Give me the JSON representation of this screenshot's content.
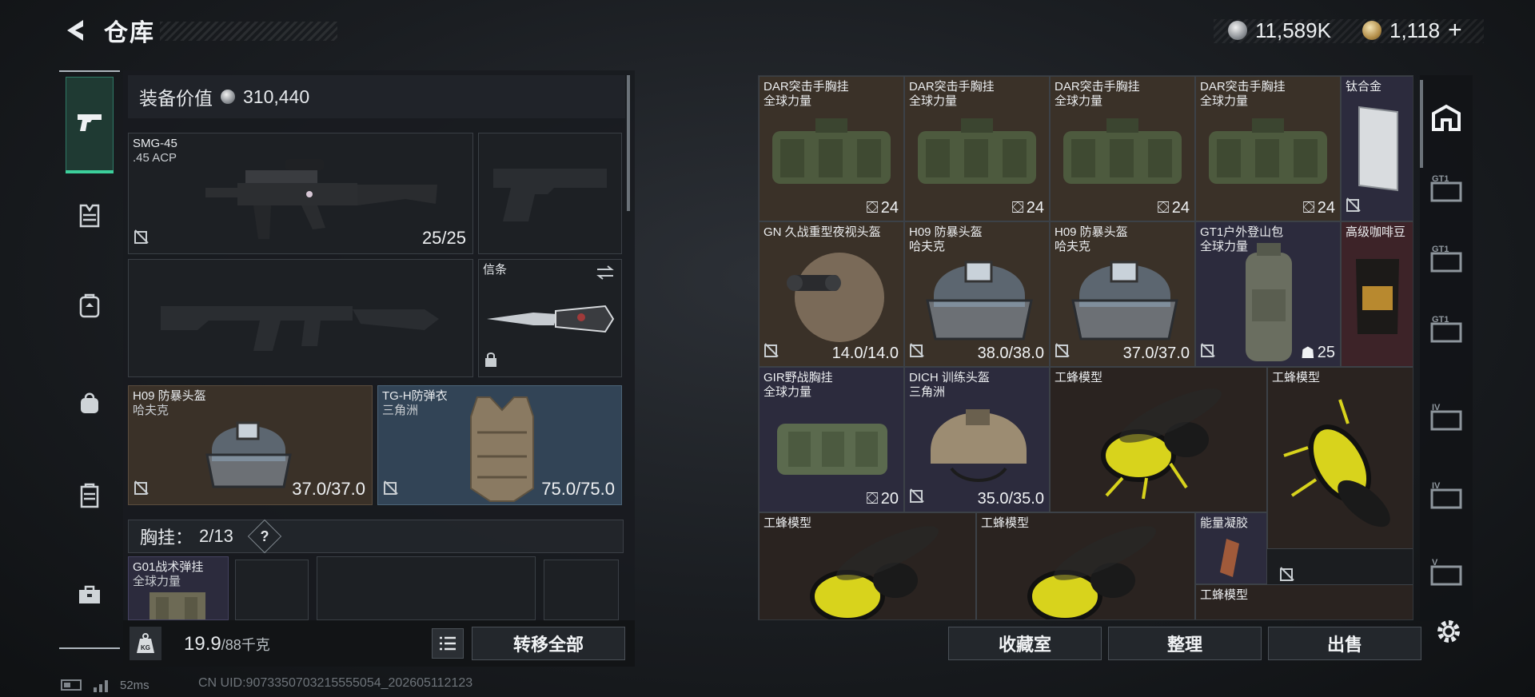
{
  "header": {
    "title": "仓库"
  },
  "currency": {
    "silver": "11,589K",
    "gold": "1,118",
    "add": "+"
  },
  "loadout": {
    "value_label": "装备价值",
    "value": "310,440",
    "primary": {
      "name": "SMG-45",
      "ammo": ".45 ACP",
      "count": "25/25"
    },
    "melee": {
      "name": "信条"
    },
    "helmet": {
      "name": "H09 防暴头盔",
      "maker": "哈夫克",
      "durability": "37.0/37.0"
    },
    "armor": {
      "name": "TG-H防弹衣",
      "maker": "三角洲",
      "durability": "75.0/75.0"
    },
    "chest_rig": {
      "label": "胸挂：",
      "count": "2/13",
      "help": "?"
    },
    "chest_item": {
      "name": "G01战术弹挂",
      "maker": "全球力量"
    }
  },
  "weight": {
    "current": "19.9",
    "max": "/88千克",
    "icon": "KG"
  },
  "buttons": {
    "transfer_all": "转移全部",
    "collection": "收藏室",
    "organize": "整理",
    "sell": "出售"
  },
  "stash": {
    "r1": [
      {
        "name": "DAR突击手胸挂",
        "maker": "全球力量",
        "count": "24"
      },
      {
        "name": "DAR突击手胸挂",
        "maker": "全球力量",
        "count": "24"
      },
      {
        "name": "DAR突击手胸挂",
        "maker": "全球力量",
        "count": "24"
      },
      {
        "name": "DAR突击手胸挂",
        "maker": "全球力量",
        "count": "24"
      },
      {
        "name": "钛合金"
      }
    ],
    "r2": [
      {
        "name": "GN 久战重型夜视头盔",
        "durability": "14.0/14.0"
      },
      {
        "name": "H09 防暴头盔",
        "maker": "哈夫克",
        "durability": "38.0/38.0"
      },
      {
        "name": "H09 防暴头盔",
        "maker": "哈夫克",
        "durability": "37.0/37.0"
      },
      {
        "name": "GT1户外登山包",
        "maker": "全球力量",
        "count": "25"
      },
      {
        "name": "高级咖啡豆"
      }
    ],
    "r3": [
      {
        "name": "GIR野战胸挂",
        "maker": "全球力量",
        "count": "20"
      },
      {
        "name": "DICH 训练头盔",
        "maker": "三角洲",
        "durability": "35.0/35.0"
      },
      {
        "name": "工蜂模型"
      },
      {
        "name": "工蜂模型"
      }
    ],
    "r4": [
      {
        "name": "工蜂模型"
      },
      {
        "name": "工蜂模型"
      },
      {
        "name": "能量凝胶"
      },
      {
        "name": "工蜂模型"
      }
    ]
  },
  "tabs": {
    "t1": "GT1",
    "t2": "GT1",
    "t3": "GT1",
    "t4": "IV",
    "t5": "IV",
    "t6": "V"
  },
  "status": {
    "ping": "52ms",
    "uid": "CN UID:9073350703215555054_202605112123"
  }
}
